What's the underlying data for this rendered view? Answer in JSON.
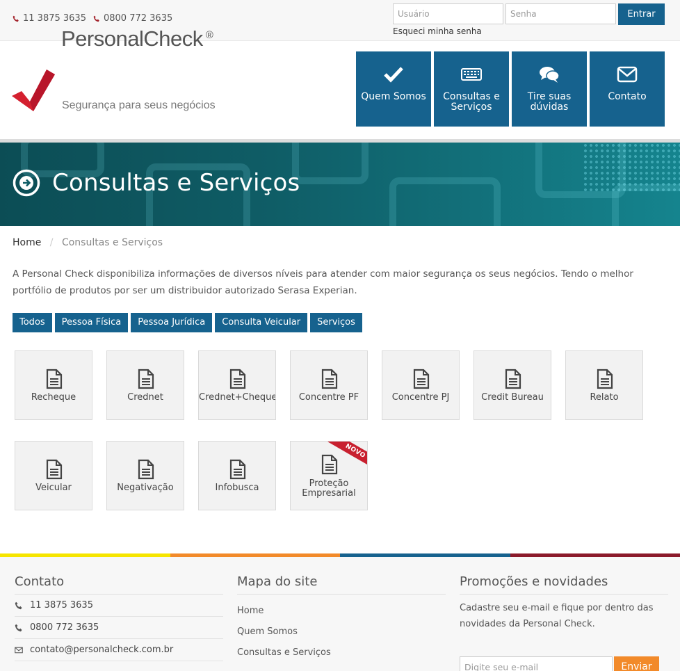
{
  "topbar": {
    "phones": [
      "11 3875 3635",
      "0800 772 3635"
    ],
    "user_placeholder": "Usuário",
    "pass_placeholder": "Senha",
    "login_label": "Entrar",
    "forgot_label": "Esqueci minha senha"
  },
  "logo": {
    "name_light": "Personal",
    "name_bold": "Check",
    "reg_mark": "®",
    "tagline": "Segurança para seus negócios"
  },
  "nav": [
    {
      "label": "Quem Somos",
      "icon": "check-icon"
    },
    {
      "label": "Consultas e Serviços",
      "icon": "keyboard-icon"
    },
    {
      "label": "Tire suas dúvidas",
      "icon": "chat-bubbles-icon"
    },
    {
      "label": "Contato",
      "icon": "envelope-icon"
    }
  ],
  "banner": {
    "title": "Consultas e Serviços",
    "icon": "circle-arrow-right-icon"
  },
  "breadcrumb": {
    "home": "Home",
    "separator": "/",
    "current": "Consultas e Serviços"
  },
  "intro": "A Personal Check disponibiliza informações de diversos níveis para atender com maior segurança os seus negócios. Tendo o melhor portfólio de produtos por ser um distribuidor autorizado Serasa Experian.",
  "filters": [
    "Todos",
    "Pessoa Física",
    "Pessoa Jurídica",
    "Consulta Veicular",
    "Serviços"
  ],
  "products": [
    {
      "label": "Recheque"
    },
    {
      "label": "Crednet"
    },
    {
      "label": "Crednet+Cheque"
    },
    {
      "label": "Concentre PF"
    },
    {
      "label": "Concentre PJ"
    },
    {
      "label": "Credit Bureau"
    },
    {
      "label": "Relato"
    },
    {
      "label": "Veicular"
    },
    {
      "label": "Negativação"
    },
    {
      "label": "Infobusca"
    },
    {
      "label": "Proteção Empresarial",
      "badge": "NOVO"
    }
  ],
  "colors": {
    "primary": "#16628e",
    "accent": "#f28a2a",
    "badge": "#c8202f",
    "strip": [
      "#f6e500",
      "#f28a2a",
      "#16628e",
      "#8b1a2b"
    ]
  },
  "footer": {
    "contact": {
      "title": "Contato",
      "items": [
        {
          "icon": "phone-icon",
          "text": "11 3875 3635"
        },
        {
          "icon": "phone-icon",
          "text": "0800 772 3635"
        },
        {
          "icon": "envelope-icon",
          "text": "contato@personalcheck.com.br"
        }
      ]
    },
    "sitemap": {
      "title": "Mapa do site",
      "links": [
        "Home",
        "Quem Somos",
        "Consultas e Serviços"
      ]
    },
    "promo": {
      "title": "Promoções e novidades",
      "text": "Cadastre seu e-mail e fique por dentro das novidades da Personal Check.",
      "email_placeholder": "Digite seu e-mail",
      "send_label": "Enviar"
    }
  }
}
